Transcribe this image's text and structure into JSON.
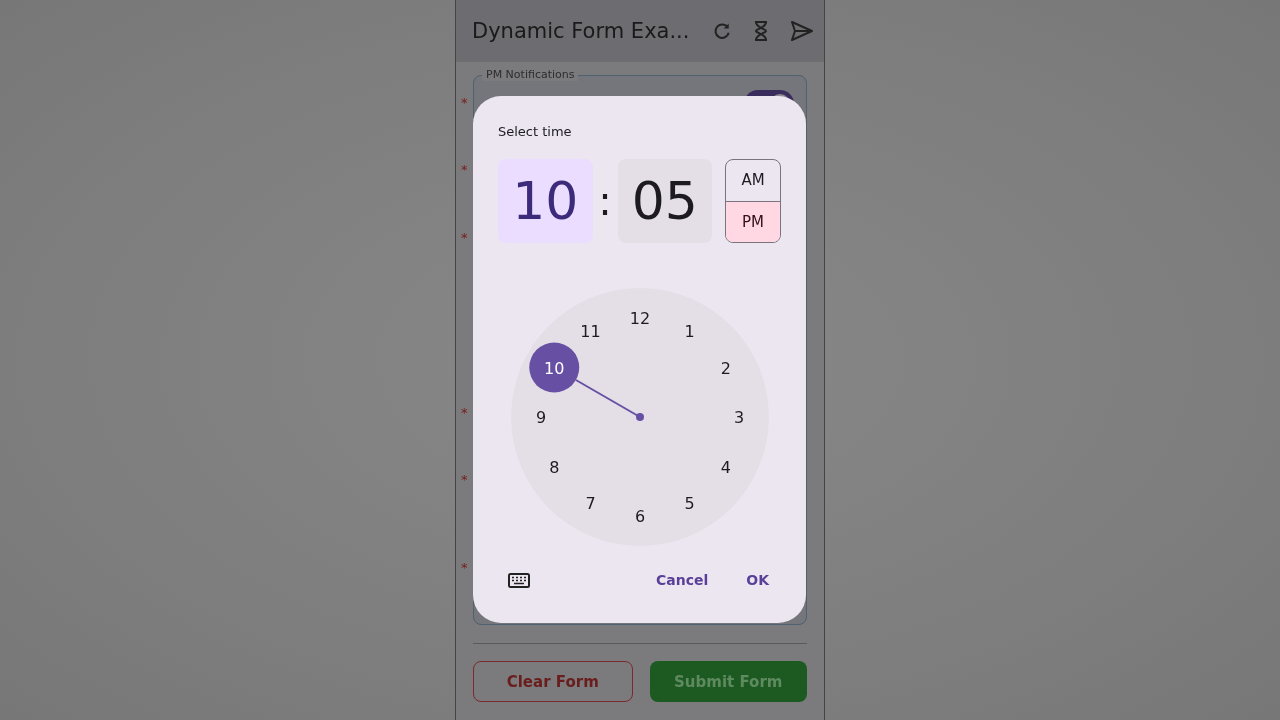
{
  "app_bar": {
    "title": "Dynamic Form Exa..."
  },
  "form": {
    "section_label": "PM Notifications",
    "required_marks": [
      "*",
      "*",
      "*",
      "*",
      "*",
      "*"
    ],
    "switch": {
      "on": true
    }
  },
  "buttons": [
    {
      "label": "Clear Form",
      "kind": "outline"
    },
    {
      "label": "Submit Form",
      "kind": "filled"
    }
  ],
  "dialog": {
    "title": "Select time",
    "hour": {
      "value": "10",
      "selected": true
    },
    "separator": ":",
    "minute": {
      "value": "05",
      "selected": false
    },
    "periods": [
      {
        "label": "AM",
        "selected": false
      },
      {
        "label": "PM",
        "selected": true
      }
    ],
    "dial": [
      {
        "label": "12",
        "selected": false
      },
      {
        "label": "1",
        "selected": false
      },
      {
        "label": "2",
        "selected": false
      },
      {
        "label": "3",
        "selected": false
      },
      {
        "label": "4",
        "selected": false
      },
      {
        "label": "5",
        "selected": false
      },
      {
        "label": "6",
        "selected": false
      },
      {
        "label": "7",
        "selected": false
      },
      {
        "label": "8",
        "selected": false
      },
      {
        "label": "9",
        "selected": false
      },
      {
        "label": "10",
        "selected": true
      },
      {
        "label": "11",
        "selected": false
      }
    ],
    "actions": [
      "Cancel",
      "OK"
    ]
  }
}
